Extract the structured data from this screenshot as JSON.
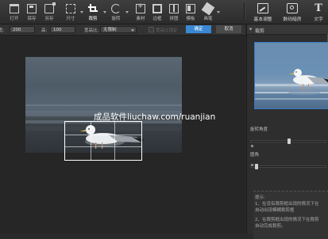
{
  "toolbar": {
    "tools": [
      {
        "label": "打开",
        "icon": "folder-open-icon"
      },
      {
        "label": "保存",
        "icon": "save-icon"
      },
      {
        "label": "另存",
        "icon": "save-as-icon"
      },
      {
        "label": "尺寸",
        "icon": "resize-icon"
      },
      {
        "label": "裁剪",
        "icon": "crop-icon"
      },
      {
        "label": "旋转",
        "icon": "rotate-icon"
      },
      {
        "label": "素材",
        "icon": "add-material-icon"
      },
      {
        "label": "边框",
        "icon": "frame-icon"
      },
      {
        "label": "拼图",
        "icon": "puzzle-icon"
      },
      {
        "label": "模板",
        "icon": "template-icon"
      },
      {
        "label": "画笔",
        "icon": "brush-icon"
      }
    ],
    "right_tools": [
      {
        "label": "基本调整",
        "icon": "adjust-icon"
      },
      {
        "label": "数码暗房",
        "icon": "camera-icon"
      },
      {
        "label": "文字",
        "icon": "text-icon"
      }
    ]
  },
  "options": {
    "width_label": "宽:",
    "width_value": "200",
    "height_label": "高:",
    "height_value": "100",
    "ratio_label": "宽高比:",
    "ratio_value": "无限制",
    "lock_label": "宽高比锁定",
    "ok_label": "确定",
    "cancel_label": "取消"
  },
  "watermark": "成品软件liuchaw.com/ruanjian",
  "panel": {
    "title": "裁剪",
    "rotation_label": "旋转角度",
    "rotation_value": 0.5,
    "corner_label": "圆角",
    "corner_value": 0.05,
    "tips_title": "提示:",
    "tips": [
      "1、在没有裁剪框出现的情况下在",
      "   自动出现模糊裁剪框",
      "2、在裁剪框出现的情况下在裁剪",
      "   自动完成裁剪。"
    ]
  },
  "colors": {
    "accent": "#3a88d4",
    "preview_border": "#3a78c0"
  }
}
